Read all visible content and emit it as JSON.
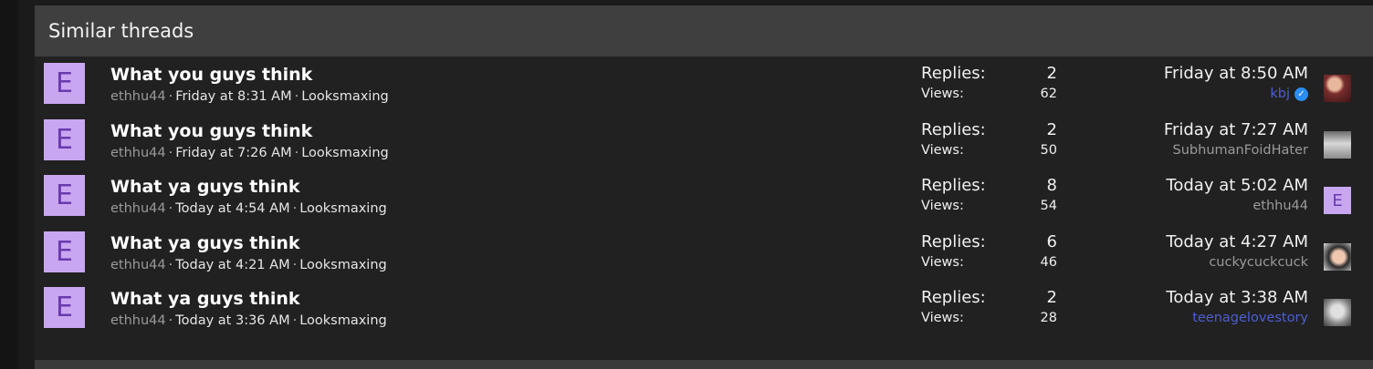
{
  "block": {
    "title": "Similar threads"
  },
  "labels": {
    "replies": "Replies:",
    "views": "Views:",
    "sep": "·"
  },
  "threads": [
    {
      "avatar_letter": "E",
      "title": "What you guys think",
      "author": "ethhu44",
      "started": "Friday at 8:31 AM",
      "forum": "Looksmaxing",
      "replies": "2",
      "views": "62",
      "last_date": "Friday at 8:50 AM",
      "last_user": "kbj",
      "last_user_verified": true,
      "last_avatar": "photo-avatar-1"
    },
    {
      "avatar_letter": "E",
      "title": "What you guys think",
      "author": "ethhu44",
      "started": "Friday at 7:26 AM",
      "forum": "Looksmaxing",
      "replies": "2",
      "views": "50",
      "last_date": "Friday at 7:27 AM",
      "last_user": "SubhumanFoidHater",
      "last_user_verified": false,
      "last_avatar": "photo-avatar-2"
    },
    {
      "avatar_letter": "E",
      "title": "What ya guys think",
      "author": "ethhu44",
      "started": "Today at 4:54 AM",
      "forum": "Looksmaxing",
      "replies": "8",
      "views": "54",
      "last_date": "Today at 5:02 AM",
      "last_user": "ethhu44",
      "last_user_verified": false,
      "last_avatar_letter": "E"
    },
    {
      "avatar_letter": "E",
      "title": "What ya guys think",
      "author": "ethhu44",
      "started": "Today at 4:21 AM",
      "forum": "Looksmaxing",
      "replies": "6",
      "views": "46",
      "last_date": "Today at 4:27 AM",
      "last_user": "cuckycuckcuck",
      "last_user_verified": false,
      "last_avatar": "photo-avatar-3"
    },
    {
      "avatar_letter": "E",
      "title": "What ya guys think",
      "author": "ethhu44",
      "started": "Today at 3:36 AM",
      "forum": "Looksmaxing",
      "replies": "2",
      "views": "28",
      "last_date": "Today at 3:38 AM",
      "last_user": "teenagelovestory",
      "last_user_verified": false,
      "last_avatar": "photo-avatar-4"
    }
  ],
  "colors": {
    "header_bg": "#3f3f3f",
    "block_bg": "#212121",
    "letter_avatar_bg": "#c9a6f0",
    "letter_avatar_fg": "#6a3aaf",
    "username_blue": "#4d5fd1",
    "verified_badge": "#2a8df2"
  }
}
